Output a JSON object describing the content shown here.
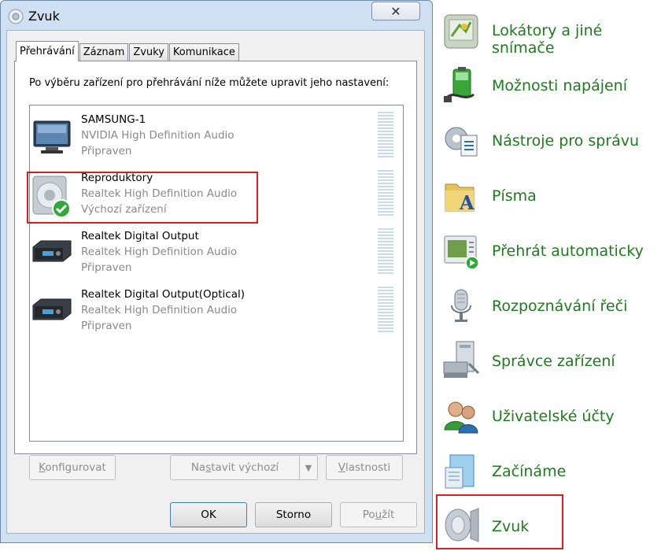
{
  "dialog": {
    "title": "Zvuk",
    "close_glyph": "✕",
    "tabs": [
      {
        "label": "Přehrávání",
        "active": true
      },
      {
        "label": "Záznam",
        "active": false
      },
      {
        "label": "Zvuky",
        "active": false
      },
      {
        "label": "Komunikace",
        "active": false
      }
    ],
    "instruction": "Po výběru zařízení pro přehrávání níže můžete upravit jeho nastavení:",
    "devices": [
      {
        "name": "SAMSUNG-1",
        "driver": "NVIDIA High Definition Audio",
        "status": "Připraven",
        "icon": "monitor-icon"
      },
      {
        "name": "Reproduktory",
        "driver": "Realtek High Definition Audio",
        "status": "Výchozí zařízení",
        "icon": "speaker-icon",
        "selected": true
      },
      {
        "name": "Realtek Digital Output",
        "driver": "Realtek High Definition Audio",
        "status": "Připraven",
        "icon": "receiver-icon"
      },
      {
        "name": "Realtek Digital Output(Optical)",
        "driver": "Realtek High Definition Audio",
        "status": "Připraven",
        "icon": "receiver-icon"
      }
    ],
    "buttons": {
      "configure": "Konfigurovat",
      "configure_key": "K",
      "configure_rest": "onfigurovat",
      "set_default_a": "Na",
      "set_default_key": "s",
      "set_default_b": "tavit výchozí",
      "properties_key": "V",
      "properties_rest": "lastnosti",
      "ok": "OK",
      "cancel": "Storno",
      "apply_a": "Po",
      "apply_key": "u",
      "apply_b": "žít"
    }
  },
  "control_panel": {
    "items": [
      {
        "label": "Lokátory a jiné snímače",
        "icon": "location-sensor-icon"
      },
      {
        "label": "Možnosti napájení",
        "icon": "power-options-icon"
      },
      {
        "label": "Nástroje pro správu",
        "icon": "admin-tools-icon"
      },
      {
        "label": "Písma",
        "icon": "fonts-folder-icon"
      },
      {
        "label": "Přehrát automaticky",
        "icon": "autoplay-icon"
      },
      {
        "label": "Rozpoznávání řeči",
        "icon": "microphone-icon"
      },
      {
        "label": "Správce zařízení",
        "icon": "device-manager-icon"
      },
      {
        "label": "Uživatelské účty",
        "icon": "user-accounts-icon"
      },
      {
        "label": "Začínáme",
        "icon": "getting-started-icon"
      },
      {
        "label": "Zvuk",
        "icon": "sound-icon"
      }
    ],
    "label_color": "#1e7b1e",
    "highlight_color": "#d42020"
  }
}
